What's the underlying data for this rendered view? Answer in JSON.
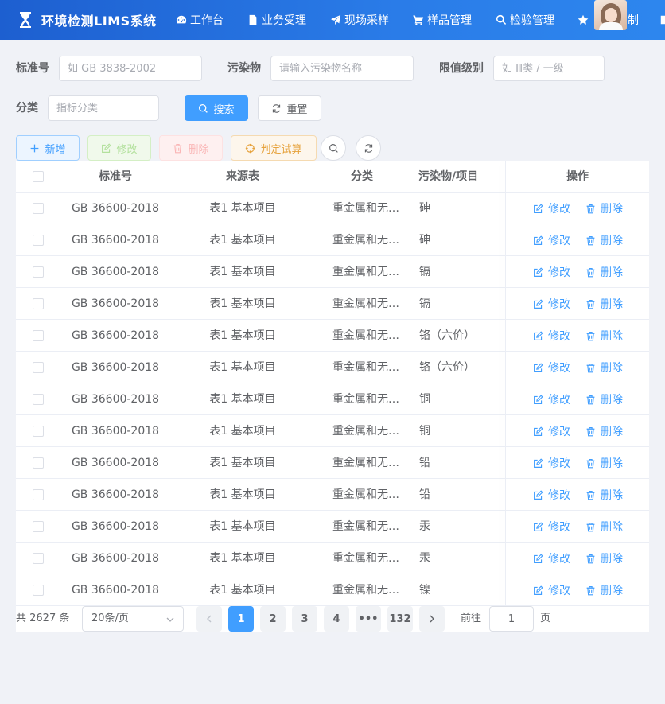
{
  "app": {
    "title": "环境检测LIMS系统"
  },
  "nav": [
    {
      "label": "工作台",
      "icon": "dashboard-icon"
    },
    {
      "label": "业务受理",
      "icon": "document-icon"
    },
    {
      "label": "现场采样",
      "icon": "send-icon"
    },
    {
      "label": "样品管理",
      "icon": "cart-icon"
    },
    {
      "label": "检验管理",
      "icon": "search-icon"
    },
    {
      "label": "",
      "icon": "star-icon"
    }
  ],
  "nav_overflow": "制",
  "search_form": {
    "standard_no": {
      "label": "标准号",
      "placeholder": "如 GB 3838-2002"
    },
    "pollutant": {
      "label": "污染物",
      "placeholder": "请输入污染物名称"
    },
    "limit_level": {
      "label": "限值级别",
      "placeholder": "如 Ⅲ类 / 一级"
    },
    "category": {
      "label": "分类",
      "placeholder": "指标分类"
    },
    "search_label": "搜索",
    "reset_label": "重置"
  },
  "toolbar": {
    "add_label": "新增",
    "edit_label": "修改",
    "delete_label": "删除",
    "judge_label": "判定试算"
  },
  "table": {
    "columns": [
      "标准号",
      "来源表",
      "分类",
      "污染物/项目",
      "操作"
    ],
    "edit_label": "修改",
    "delete_label": "删除",
    "rows": [
      {
        "standard": "GB 36600-2018",
        "source": "表1 基本项目",
        "category": "重金属和无…",
        "pollutant": "砷"
      },
      {
        "standard": "GB 36600-2018",
        "source": "表1 基本项目",
        "category": "重金属和无…",
        "pollutant": "砷"
      },
      {
        "standard": "GB 36600-2018",
        "source": "表1 基本项目",
        "category": "重金属和无…",
        "pollutant": "镉"
      },
      {
        "standard": "GB 36600-2018",
        "source": "表1 基本项目",
        "category": "重金属和无…",
        "pollutant": "镉"
      },
      {
        "standard": "GB 36600-2018",
        "source": "表1 基本项目",
        "category": "重金属和无…",
        "pollutant": "铬（六价）"
      },
      {
        "standard": "GB 36600-2018",
        "source": "表1 基本项目",
        "category": "重金属和无…",
        "pollutant": "铬（六价）"
      },
      {
        "standard": "GB 36600-2018",
        "source": "表1 基本项目",
        "category": "重金属和无…",
        "pollutant": "铜"
      },
      {
        "standard": "GB 36600-2018",
        "source": "表1 基本项目",
        "category": "重金属和无…",
        "pollutant": "铜"
      },
      {
        "standard": "GB 36600-2018",
        "source": "表1 基本项目",
        "category": "重金属和无…",
        "pollutant": "铅"
      },
      {
        "standard": "GB 36600-2018",
        "source": "表1 基本项目",
        "category": "重金属和无…",
        "pollutant": "铅"
      },
      {
        "standard": "GB 36600-2018",
        "source": "表1 基本项目",
        "category": "重金属和无…",
        "pollutant": "汞"
      },
      {
        "standard": "GB 36600-2018",
        "source": "表1 基本项目",
        "category": "重金属和无…",
        "pollutant": "汞"
      },
      {
        "standard": "GB 36600-2018",
        "source": "表1 基本项目",
        "category": "重金属和无…",
        "pollutant": "镍"
      }
    ]
  },
  "pagination": {
    "total_text": "共 2627 条",
    "page_size_text": "20条/页",
    "pages": [
      "1",
      "2",
      "3",
      "4",
      "•••",
      "132"
    ],
    "current_page": "1",
    "goto_label": "前往",
    "goto_value": "1",
    "page_unit": "页"
  },
  "colors": {
    "primary": "#409eff",
    "nav_start": "#1d5fd0",
    "nav_end": "#2d86ee",
    "warning": "#e6a23c"
  }
}
